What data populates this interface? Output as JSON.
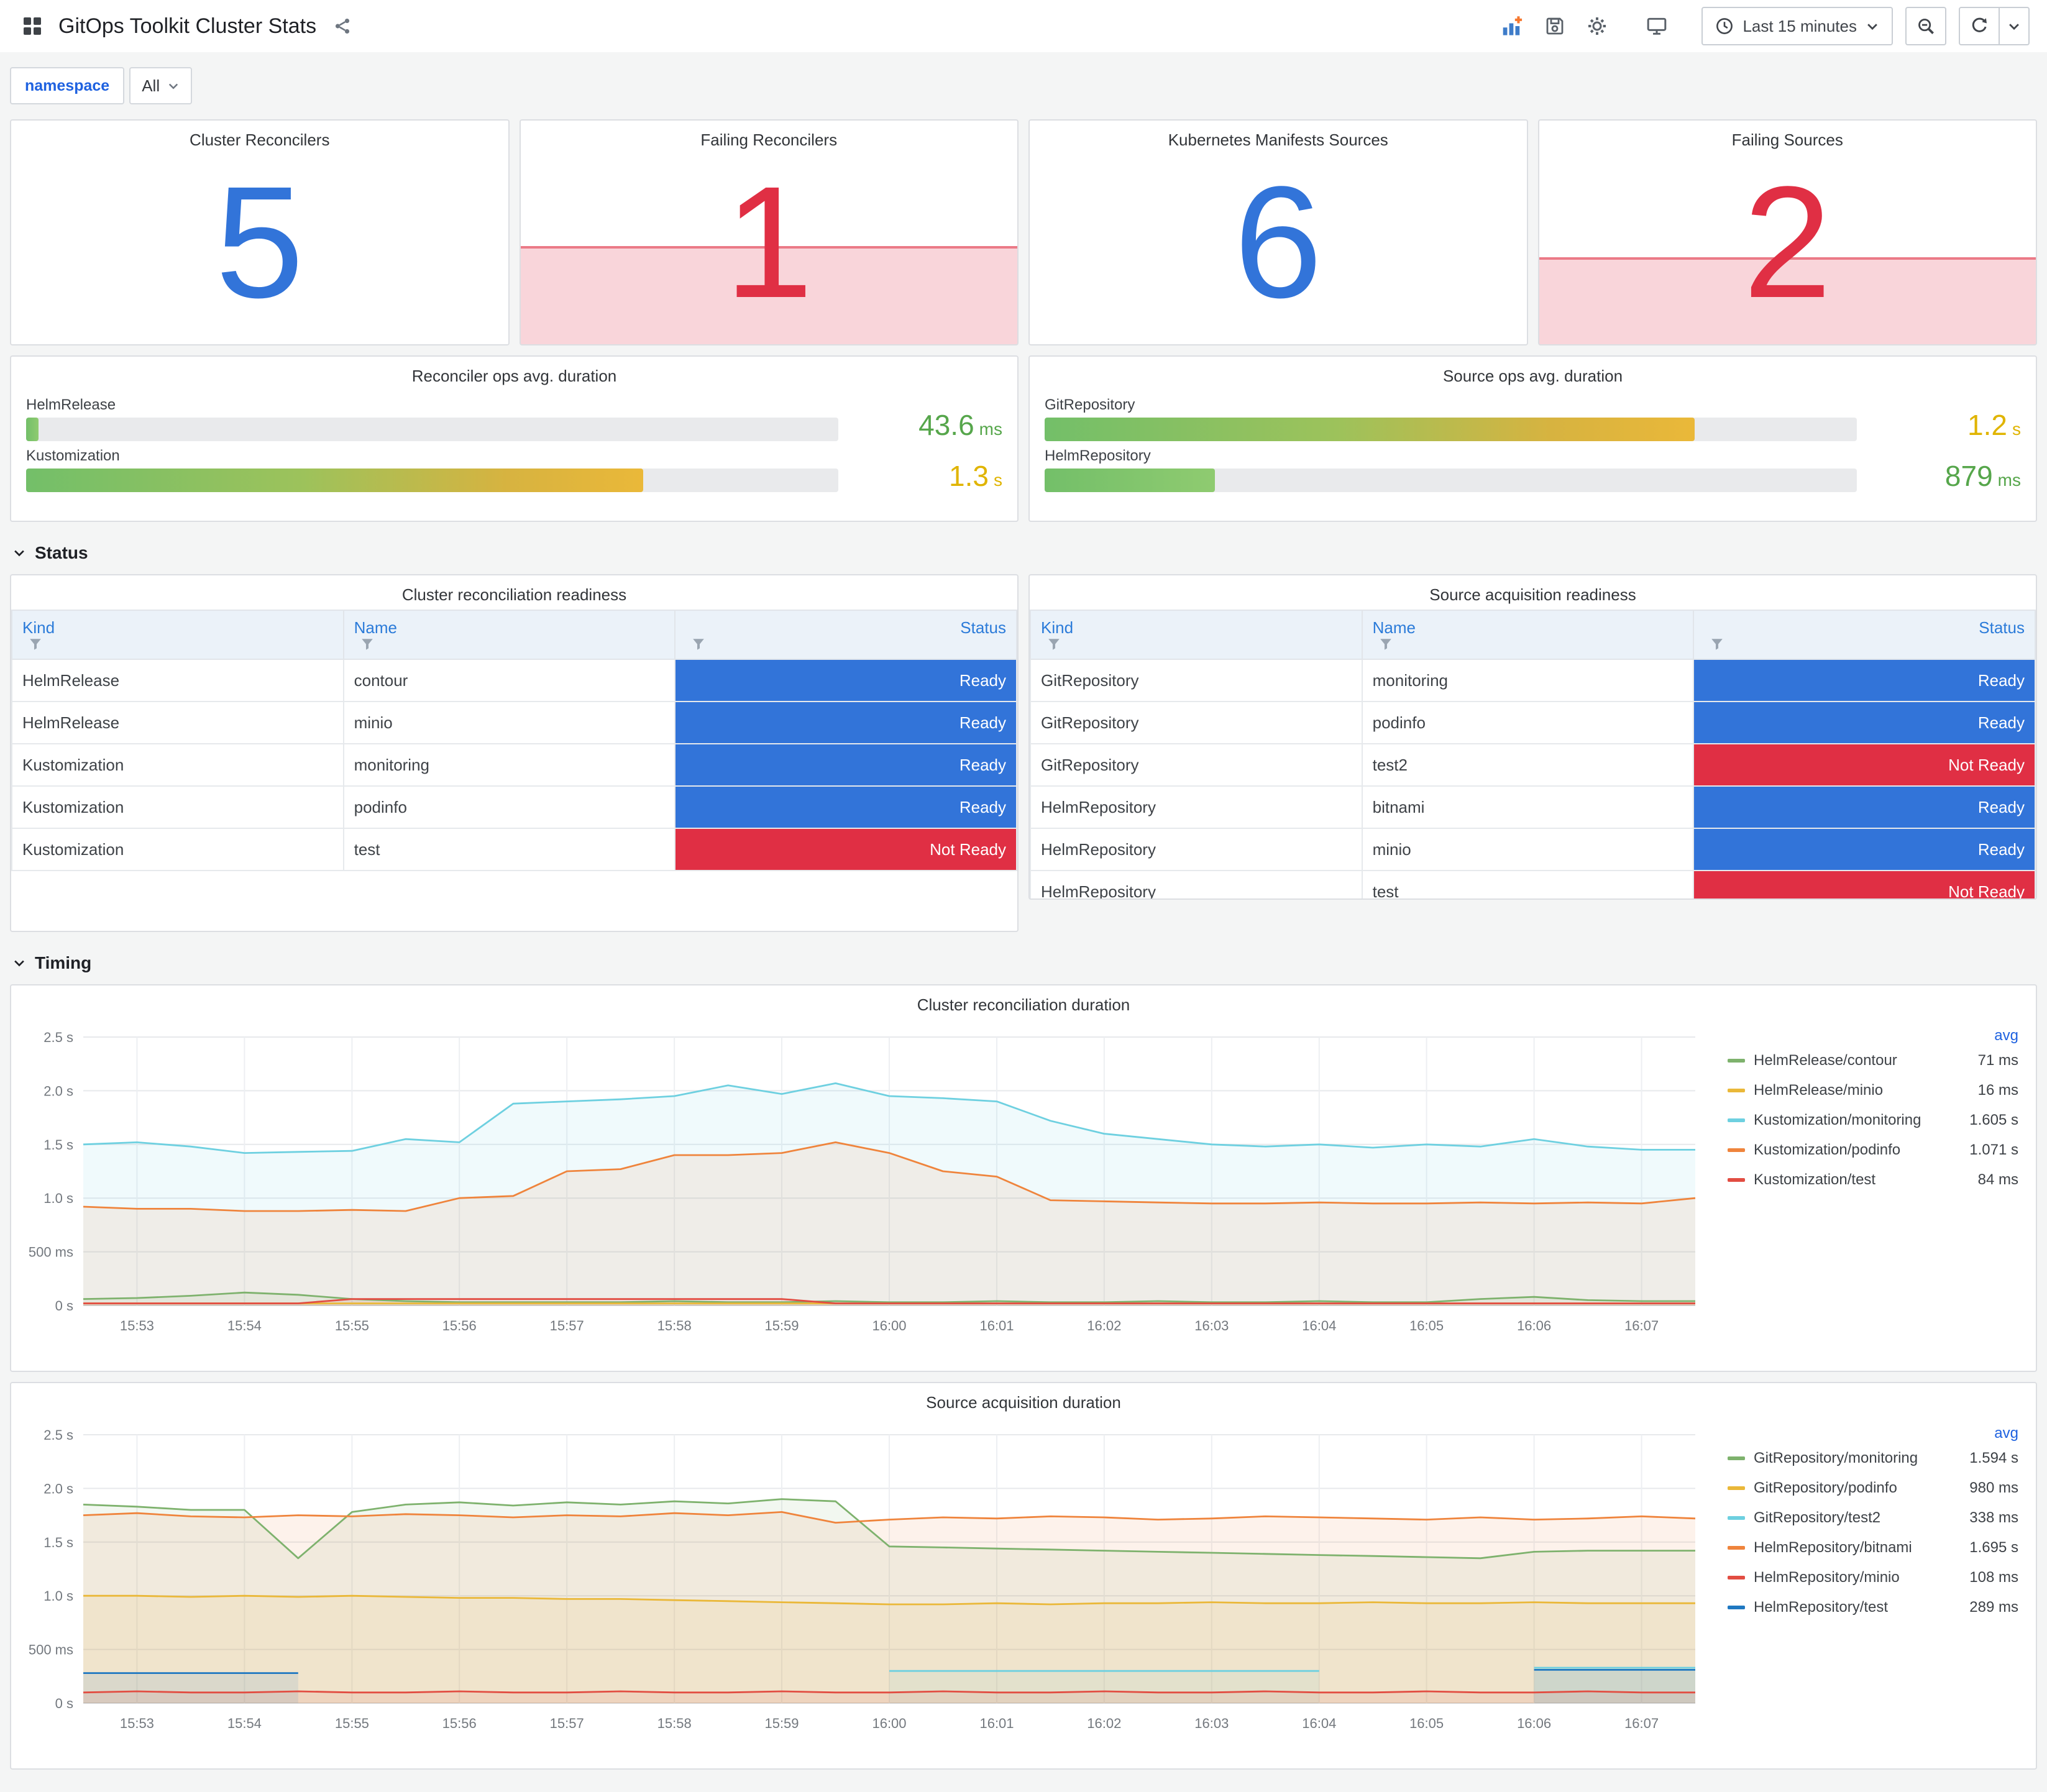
{
  "header": {
    "title": "GitOps Toolkit Cluster Stats",
    "time_picker": "Last 15 minutes"
  },
  "variables": [
    {
      "label": "namespace",
      "value": "All"
    }
  ],
  "sections": [
    {
      "label": "Status"
    },
    {
      "label": "Timing"
    }
  ],
  "colors": {
    "stat_blue": "#3274D9",
    "stat_red": "#E02F44",
    "value_green": "#56A64B",
    "value_yellow": "#E0B400",
    "ready_bg": "#3274D9",
    "not_ready_bg": "#E02F44",
    "header_link_blue": "#1F62E0"
  },
  "stat_panels": [
    {
      "title": "Cluster Reconcilers",
      "value": "5",
      "state": "ok"
    },
    {
      "title": "Failing Reconcilers",
      "value": "1",
      "state": "alert",
      "spark_height_pct": 44
    },
    {
      "title": "Kubernetes Manifests Sources",
      "value": "6",
      "state": "ok"
    },
    {
      "title": "Failing Sources",
      "value": "2",
      "state": "alert",
      "spark_height_pct": 39
    }
  ],
  "gauge_panels": [
    {
      "title": "Reconciler ops avg. duration",
      "bars": [
        {
          "label": "HelmRelease",
          "value": "43.6",
          "unit": "ms",
          "pct": 1.5,
          "value_color": "#56A64B",
          "fill": "green"
        },
        {
          "label": "Kustomization",
          "value": "1.3",
          "unit": "s",
          "pct": 76,
          "value_color": "#E0B400",
          "fill": "green-yellow"
        }
      ]
    },
    {
      "title": "Source ops avg. duration",
      "bars": [
        {
          "label": "GitRepository",
          "value": "1.2",
          "unit": "s",
          "pct": 80,
          "value_color": "#E0B400",
          "fill": "green-yellow"
        },
        {
          "label": "HelmRepository",
          "value": "879",
          "unit": "ms",
          "pct": 21,
          "value_color": "#56A64B",
          "fill": "green"
        }
      ]
    }
  ],
  "table_panels": [
    {
      "title": "Cluster reconciliation readiness",
      "columns": [
        "Kind",
        "Name",
        "Status"
      ],
      "rows": [
        {
          "kind": "HelmRelease",
          "name": "contour",
          "status": "Ready"
        },
        {
          "kind": "HelmRelease",
          "name": "minio",
          "status": "Ready"
        },
        {
          "kind": "Kustomization",
          "name": "monitoring",
          "status": "Ready"
        },
        {
          "kind": "Kustomization",
          "name": "podinfo",
          "status": "Ready"
        },
        {
          "kind": "Kustomization",
          "name": "test",
          "status": "Not Ready"
        }
      ]
    },
    {
      "title": "Source acquisition readiness",
      "columns": [
        "Kind",
        "Name",
        "Status"
      ],
      "rows": [
        {
          "kind": "GitRepository",
          "name": "monitoring",
          "status": "Ready"
        },
        {
          "kind": "GitRepository",
          "name": "podinfo",
          "status": "Ready"
        },
        {
          "kind": "GitRepository",
          "name": "test2",
          "status": "Not Ready"
        },
        {
          "kind": "HelmRepository",
          "name": "bitnami",
          "status": "Ready"
        },
        {
          "kind": "HelmRepository",
          "name": "minio",
          "status": "Ready"
        },
        {
          "kind": "HelmRepository",
          "name": "test",
          "status": "Not Ready"
        }
      ]
    }
  ],
  "chart_data": [
    {
      "type": "line",
      "title": "Cluster reconciliation duration",
      "legend_header": "avg",
      "legend_position": "right",
      "grid": true,
      "ylim": [
        0,
        2.5
      ],
      "y_ticks": [
        {
          "v": 0,
          "label": "0 s"
        },
        {
          "v": 0.5,
          "label": "500 ms"
        },
        {
          "v": 1.0,
          "label": "1.0 s"
        },
        {
          "v": 1.5,
          "label": "1.5 s"
        },
        {
          "v": 2.0,
          "label": "2.0 s"
        },
        {
          "v": 2.5,
          "label": "2.5 s"
        }
      ],
      "x_ticks": [
        "15:53",
        "15:54",
        "15:55",
        "15:56",
        "15:57",
        "15:58",
        "15:59",
        "16:00",
        "16:01",
        "16:02",
        "16:03",
        "16:04",
        "16:05",
        "16:06",
        "16:07"
      ],
      "series": [
        {
          "name": "HelmRelease/contour",
          "avg": "71 ms",
          "color": "#7EB26D",
          "values": [
            0.06,
            0.07,
            0.09,
            0.12,
            0.1,
            0.06,
            0.04,
            0.03,
            0.03,
            0.03,
            0.03,
            0.04,
            0.03,
            0.03,
            0.04,
            0.03,
            0.03,
            0.04,
            0.03,
            0.03,
            0.04,
            0.03,
            0.03,
            0.04,
            0.03,
            0.03,
            0.06,
            0.08,
            0.05,
            0.04,
            0.04
          ]
        },
        {
          "name": "HelmRelease/minio",
          "avg": "16 ms",
          "color": "#EAB839",
          "values": [
            0.02,
            0.02,
            0.02,
            0.02,
            0.02,
            0.02,
            0.02,
            0.02,
            0.02,
            0.02,
            0.02,
            0.02,
            0.02,
            0.02,
            0.02,
            0.02,
            0.02,
            0.02,
            0.02,
            0.02,
            0.02,
            0.02,
            0.02,
            0.02,
            0.02,
            0.02,
            0.02,
            0.02,
            0.02,
            0.02,
            0.02
          ]
        },
        {
          "name": "Kustomization/monitoring",
          "avg": "1.605 s",
          "color": "#6ED0E0",
          "values": [
            1.5,
            1.52,
            1.48,
            1.42,
            1.43,
            1.44,
            1.55,
            1.52,
            1.88,
            1.9,
            1.92,
            1.95,
            2.05,
            1.97,
            2.07,
            1.95,
            1.93,
            1.9,
            1.72,
            1.6,
            1.55,
            1.5,
            1.48,
            1.5,
            1.47,
            1.5,
            1.48,
            1.55,
            1.48,
            1.45,
            1.45
          ]
        },
        {
          "name": "Kustomization/podinfo",
          "avg": "1.071 s",
          "color": "#EF843C",
          "values": [
            0.92,
            0.9,
            0.9,
            0.88,
            0.88,
            0.89,
            0.88,
            1.0,
            1.02,
            1.25,
            1.27,
            1.4,
            1.4,
            1.42,
            1.52,
            1.42,
            1.25,
            1.2,
            0.98,
            0.97,
            0.96,
            0.95,
            0.95,
            0.96,
            0.95,
            0.95,
            0.96,
            0.95,
            0.96,
            0.95,
            1.0
          ]
        },
        {
          "name": "Kustomization/test",
          "avg": "84 ms",
          "color": "#E24D42",
          "values": [
            0.02,
            0.02,
            0.02,
            0.02,
            0.02,
            0.06,
            0.06,
            0.06,
            0.06,
            0.06,
            0.06,
            0.06,
            0.06,
            0.06,
            0.02,
            0.02,
            0.02,
            0.02,
            0.02,
            0.02,
            0.02,
            0.02,
            0.02,
            0.02,
            0.02,
            0.02,
            0.02,
            0.02,
            0.02,
            0.02,
            0.02
          ]
        }
      ]
    },
    {
      "type": "line",
      "title": "Source acquisition duration",
      "legend_header": "avg",
      "legend_position": "right",
      "grid": true,
      "ylim": [
        0,
        2.5
      ],
      "y_ticks": [
        {
          "v": 0,
          "label": "0 s"
        },
        {
          "v": 0.5,
          "label": "500 ms"
        },
        {
          "v": 1.0,
          "label": "1.0 s"
        },
        {
          "v": 1.5,
          "label": "1.5 s"
        },
        {
          "v": 2.0,
          "label": "2.0 s"
        },
        {
          "v": 2.5,
          "label": "2.5 s"
        }
      ],
      "x_ticks": [
        "15:53",
        "15:54",
        "15:55",
        "15:56",
        "15:57",
        "15:58",
        "15:59",
        "16:00",
        "16:01",
        "16:02",
        "16:03",
        "16:04",
        "16:05",
        "16:06",
        "16:07"
      ],
      "series": [
        {
          "name": "GitRepository/monitoring",
          "avg": "1.594 s",
          "color": "#7EB26D",
          "values": [
            1.85,
            1.83,
            1.8,
            1.8,
            1.35,
            1.78,
            1.85,
            1.87,
            1.84,
            1.87,
            1.85,
            1.88,
            1.86,
            1.9,
            1.88,
            1.46,
            1.45,
            1.44,
            1.43,
            1.42,
            1.41,
            1.4,
            1.39,
            1.38,
            1.37,
            1.36,
            1.35,
            1.41,
            1.42,
            1.42,
            1.42
          ]
        },
        {
          "name": "GitRepository/podinfo",
          "avg": "980 ms",
          "color": "#EAB839",
          "values": [
            1.0,
            1.0,
            0.99,
            1.0,
            0.99,
            1.0,
            0.99,
            0.98,
            0.98,
            0.97,
            0.97,
            0.96,
            0.95,
            0.94,
            0.93,
            0.92,
            0.92,
            0.93,
            0.92,
            0.93,
            0.93,
            0.94,
            0.93,
            0.93,
            0.94,
            0.93,
            0.93,
            0.94,
            0.93,
            0.93,
            0.93
          ]
        },
        {
          "name": "GitRepository/test2",
          "avg": "338 ms",
          "color": "#6ED0E0",
          "values": [
            null,
            null,
            null,
            null,
            null,
            null,
            null,
            null,
            null,
            null,
            null,
            null,
            null,
            null,
            null,
            0.3,
            0.3,
            0.3,
            0.3,
            0.3,
            0.3,
            0.3,
            0.3,
            0.3,
            null,
            null,
            null,
            0.33,
            0.33,
            0.33,
            0.33
          ]
        },
        {
          "name": "HelmRepository/bitnami",
          "avg": "1.695 s",
          "color": "#EF843C",
          "values": [
            1.75,
            1.77,
            1.74,
            1.73,
            1.75,
            1.74,
            1.76,
            1.75,
            1.73,
            1.75,
            1.74,
            1.77,
            1.75,
            1.78,
            1.68,
            1.71,
            1.73,
            1.72,
            1.74,
            1.73,
            1.71,
            1.72,
            1.74,
            1.73,
            1.72,
            1.71,
            1.73,
            1.71,
            1.72,
            1.74,
            1.72
          ]
        },
        {
          "name": "HelmRepository/minio",
          "avg": "108 ms",
          "color": "#E24D42",
          "values": [
            0.1,
            0.11,
            0.1,
            0.1,
            0.11,
            0.1,
            0.1,
            0.11,
            0.1,
            0.1,
            0.11,
            0.1,
            0.1,
            0.11,
            0.1,
            0.1,
            0.11,
            0.1,
            0.1,
            0.11,
            0.1,
            0.1,
            0.11,
            0.1,
            0.1,
            0.11,
            0.1,
            0.1,
            0.11,
            0.1,
            0.1
          ]
        },
        {
          "name": "HelmRepository/test",
          "avg": "289 ms",
          "color": "#1F78C1",
          "values": [
            0.28,
            0.28,
            0.28,
            0.28,
            0.28,
            null,
            null,
            null,
            null,
            null,
            null,
            null,
            null,
            null,
            null,
            null,
            null,
            null,
            null,
            null,
            null,
            null,
            null,
            null,
            null,
            null,
            null,
            0.31,
            0.31,
            0.31,
            0.31
          ]
        }
      ]
    }
  ]
}
